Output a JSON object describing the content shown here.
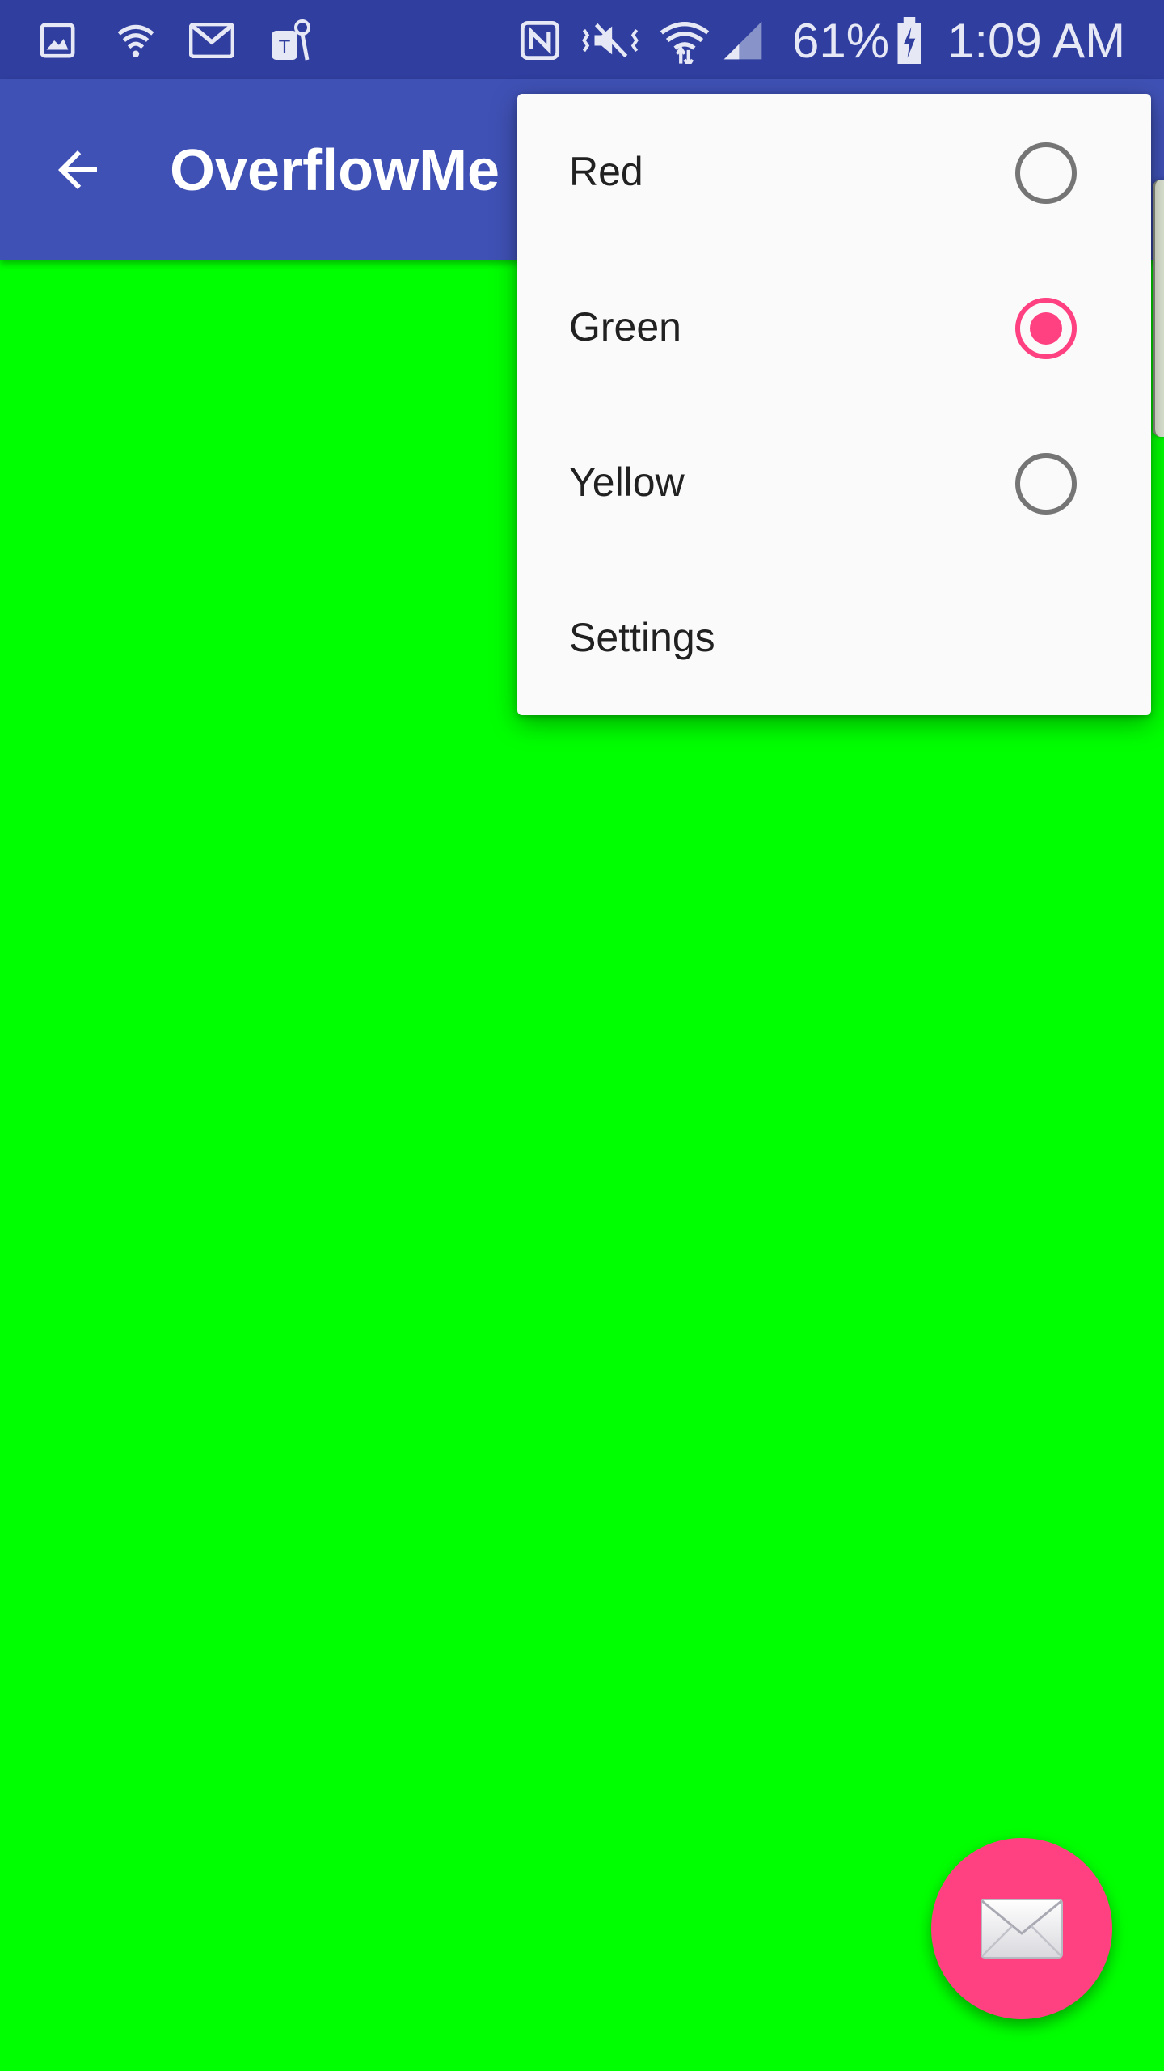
{
  "status_bar": {
    "battery_percent": "61%",
    "time": "1:09 AM",
    "left_icons": [
      "image-notification-icon",
      "wifi-notification-icon",
      "gmail-icon",
      "t-mobile-icon"
    ],
    "right_icons": [
      "nfc-icon",
      "vibrate-mute-icon",
      "wifi-signal-icon",
      "cell-signal-icon",
      "battery-charging-icon"
    ]
  },
  "app_bar": {
    "title": "OverflowMe",
    "back_icon": "arrow-back-icon",
    "color": "#3f51b5"
  },
  "menu": {
    "items": [
      {
        "label": "Red",
        "type": "radio",
        "checked": false
      },
      {
        "label": "Green",
        "type": "radio",
        "checked": true
      },
      {
        "label": "Yellow",
        "type": "radio",
        "checked": false
      },
      {
        "label": "Settings",
        "type": "action"
      }
    ],
    "accent_color": "#ff4081"
  },
  "content": {
    "background_color": "#00ff00"
  },
  "fab": {
    "icon": "email-icon",
    "color": "#ff4081"
  }
}
